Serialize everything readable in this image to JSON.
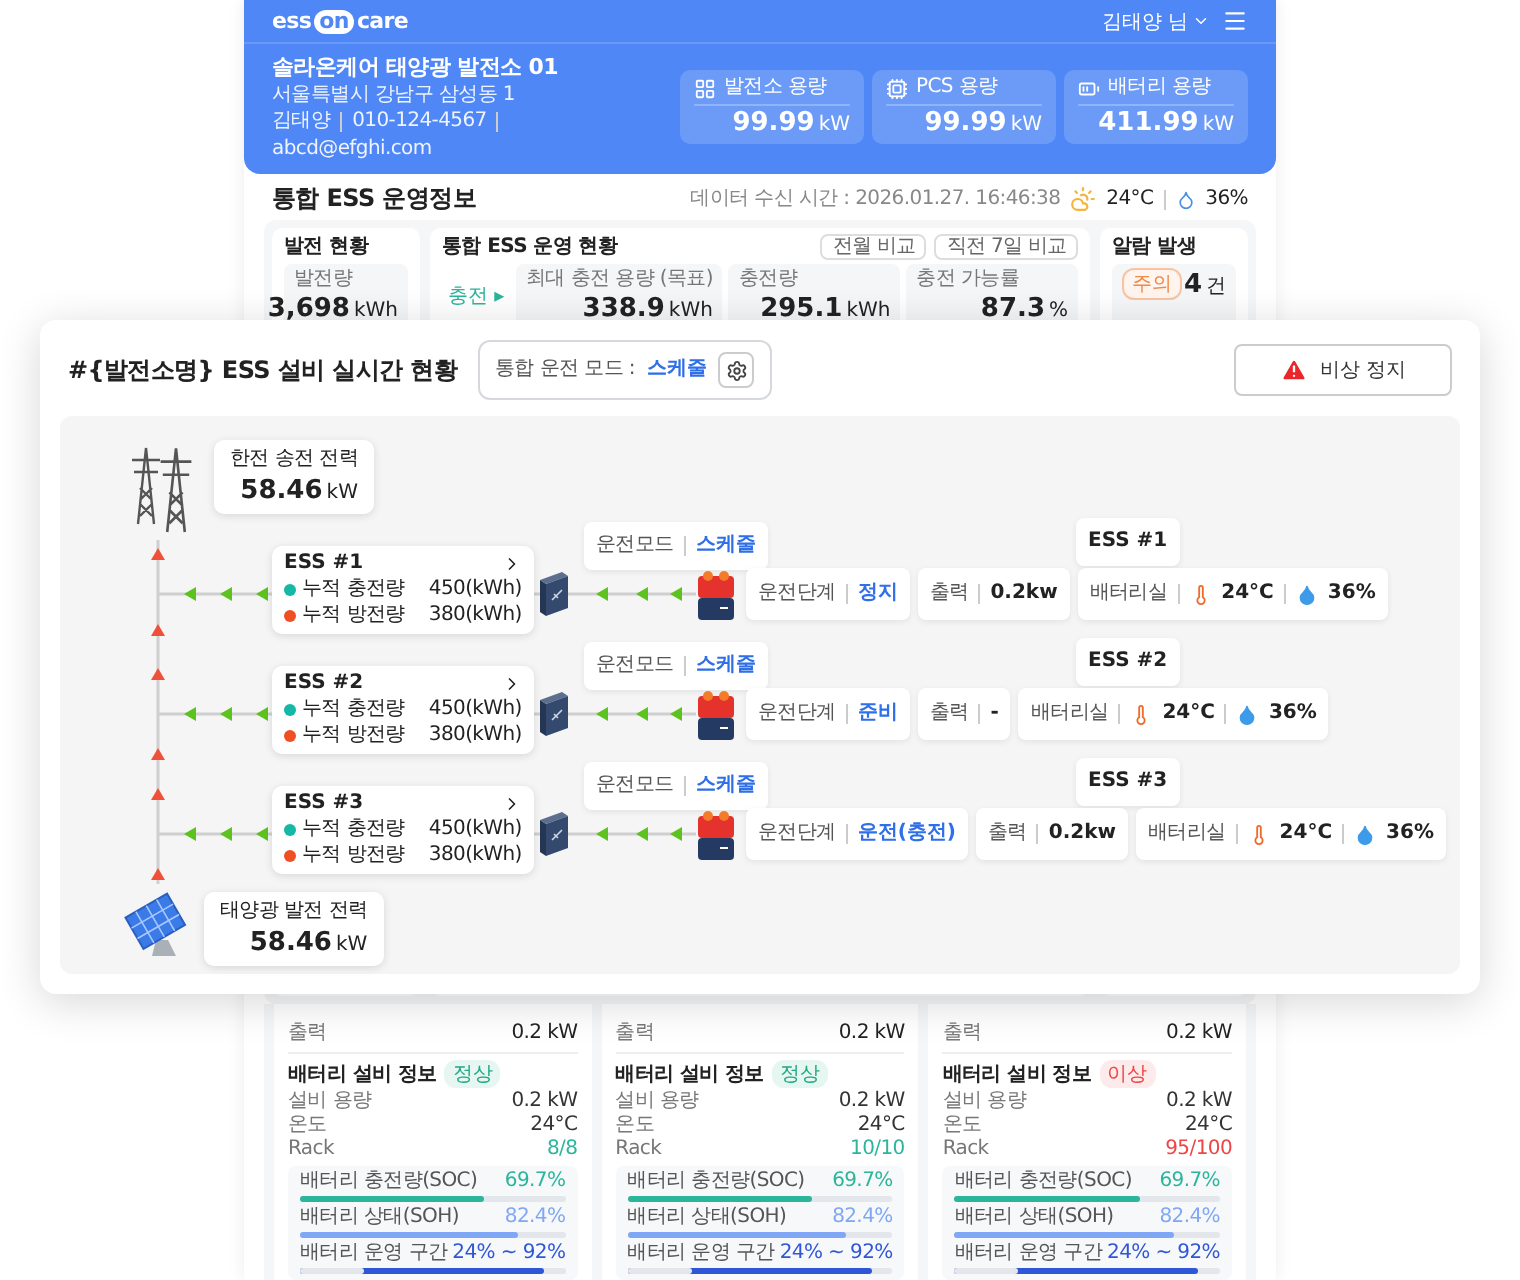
{
  "header": {
    "logo": [
      "ess",
      "on",
      "care"
    ],
    "user": "김태양 님"
  },
  "site": {
    "name": "솔라온케어 태양광 발전소 01",
    "address": "서울특별시 강남구 삼성동 1",
    "contact": [
      "김태양",
      "010-124-4567",
      "abcd@efghi.com"
    ]
  },
  "capacities": [
    {
      "kind": "plant",
      "label": "발전소 용량",
      "value": "99.99",
      "unit": "kW"
    },
    {
      "kind": "pcs",
      "label": "PCS 용량",
      "value": "99.99",
      "unit": "kW"
    },
    {
      "kind": "battery",
      "label": "배터리 용량",
      "value": "411.99",
      "unit": "kW"
    }
  ],
  "section": {
    "title": "통합 ESS 운영정보",
    "received": "데이터 수신 시간 : 2026.01.27. 16:46:38",
    "temperature": "24°C",
    "humidity": "36%"
  },
  "generation": {
    "title": "발전 현황",
    "label": "발전량",
    "value": "3,698",
    "unit": "kWh"
  },
  "operation": {
    "title": "통합 ESS 운영 현황",
    "buttons": [
      "전월 비교",
      "직전 7일 비교"
    ],
    "state": "충전 ▸",
    "metrics": [
      {
        "label": "최대 충전 용량 (목표)",
        "value": "338.9",
        "unit": "kWh"
      },
      {
        "label": "충전량",
        "value": "295.1",
        "unit": "kWh"
      },
      {
        "label": "충전 가능률",
        "value": "87.3",
        "unit": "%"
      }
    ]
  },
  "alarm": {
    "title": "알람 발생",
    "badge": "주의",
    "value": "4",
    "unit": "건"
  },
  "realtime": {
    "title": "#{발전소명} ESS 설비 실시간 현황",
    "mode_label": "통합 운전 모드 :",
    "mode": "스케줄",
    "emergency": "비상 정지",
    "grid": {
      "label": "한전 송전 전력",
      "value": "58.46",
      "unit": "kW"
    },
    "solar": {
      "label": "태양광 발전 전력",
      "value": "58.46",
      "unit": "kW"
    },
    "units": [
      {
        "name": "ESS #1",
        "stats": [
          {
            "label": "누적 충전량",
            "value": "450(kWh)",
            "color": "#14b8a6"
          },
          {
            "label": "누적 방전량",
            "value": "380(kWh)",
            "color": "#f04e23"
          }
        ],
        "mode_label": "운전모드",
        "mode": "스케줄",
        "tag": "ESS #1",
        "stage_label": "운전단계",
        "stage": "정지",
        "output_label": "출력",
        "output": "0.2kw",
        "room_label": "배터리실",
        "temperature": "24°C",
        "humidity": "36%"
      },
      {
        "name": "ESS #2",
        "stats": [
          {
            "label": "누적 충전량",
            "value": "450(kWh)",
            "color": "#14b8a6"
          },
          {
            "label": "누적 방전량",
            "value": "380(kWh)",
            "color": "#f04e23"
          }
        ],
        "mode_label": "운전모드",
        "mode": "스케줄",
        "tag": "ESS #2",
        "stage_label": "운전단계",
        "stage": "준비",
        "output_label": "출력",
        "output": "-",
        "room_label": "배터리실",
        "temperature": "24°C",
        "humidity": "36%"
      },
      {
        "name": "ESS #3",
        "stats": [
          {
            "label": "누적 충전량",
            "value": "450(kWh)",
            "color": "#14b8a6"
          },
          {
            "label": "누적 방전량",
            "value": "380(kWh)",
            "color": "#f04e23"
          }
        ],
        "mode_label": "운전모드",
        "mode": "스케줄",
        "tag": "ESS #3",
        "stage_label": "운전단계",
        "stage": "운전(충전)",
        "output_label": "출력",
        "output": "0.2kw",
        "room_label": "배터리실",
        "temperature": "24°C",
        "humidity": "36%"
      }
    ]
  },
  "battery_panels": [
    {
      "output_label": "출력",
      "output": "0.2 kW",
      "title": "배터리 설비 정보",
      "badge": "정상",
      "fault": false,
      "rows": [
        {
          "label": "설비 용량",
          "value": "0.2 kW",
          "accent": false
        },
        {
          "label": "온도",
          "value": "24°C",
          "accent": false
        },
        {
          "label": "Rack",
          "value": "8/8",
          "accent": true
        }
      ],
      "bars": [
        {
          "kind": "soc",
          "label": "배터리 충전량(SOC)",
          "reading": "69.7%",
          "level": 0.697
        },
        {
          "kind": "soh",
          "label": "배터리 상태(SOH)",
          "reading": "82.4%",
          "level": 0.824
        },
        {
          "kind": "range",
          "label": "배터리 운영 구간",
          "reading": "24% ~ 92%",
          "level": 0.92,
          "start": {
            "level": 0.24
          }
        }
      ]
    },
    {
      "output_label": "출력",
      "output": "0.2 kW",
      "title": "배터리 설비 정보",
      "badge": "정상",
      "fault": false,
      "rows": [
        {
          "label": "설비 용량",
          "value": "0.2 kW",
          "accent": false
        },
        {
          "label": "온도",
          "value": "24°C",
          "accent": false
        },
        {
          "label": "Rack",
          "value": "10/10",
          "accent": true
        }
      ],
      "bars": [
        {
          "kind": "soc",
          "label": "배터리 충전량(SOC)",
          "reading": "69.7%",
          "level": 0.697
        },
        {
          "kind": "soh",
          "label": "배터리 상태(SOH)",
          "reading": "82.4%",
          "level": 0.824
        },
        {
          "kind": "range",
          "label": "배터리 운영 구간",
          "reading": "24% ~ 92%",
          "level": 0.92,
          "start": {
            "level": 0.24
          }
        }
      ]
    },
    {
      "output_label": "출력",
      "output": "0.2 kW",
      "title": "배터리 설비 정보",
      "badge": "이상",
      "fault": true,
      "rows": [
        {
          "label": "설비 용량",
          "value": "0.2 kW",
          "accent": false
        },
        {
          "label": "온도",
          "value": "24°C",
          "accent": false
        },
        {
          "label": "Rack",
          "value": "95/100",
          "accent": true
        }
      ],
      "bars": [
        {
          "kind": "soc",
          "label": "배터리 충전량(SOC)",
          "reading": "69.7%",
          "level": 0.697
        },
        {
          "kind": "soh",
          "label": "배터리 상태(SOH)",
          "reading": "82.4%",
          "level": 0.824
        },
        {
          "kind": "range",
          "label": "배터리 운영 구간",
          "reading": "24% ~ 92%",
          "level": 0.92,
          "start": {
            "level": 0.24
          }
        }
      ]
    }
  ]
}
